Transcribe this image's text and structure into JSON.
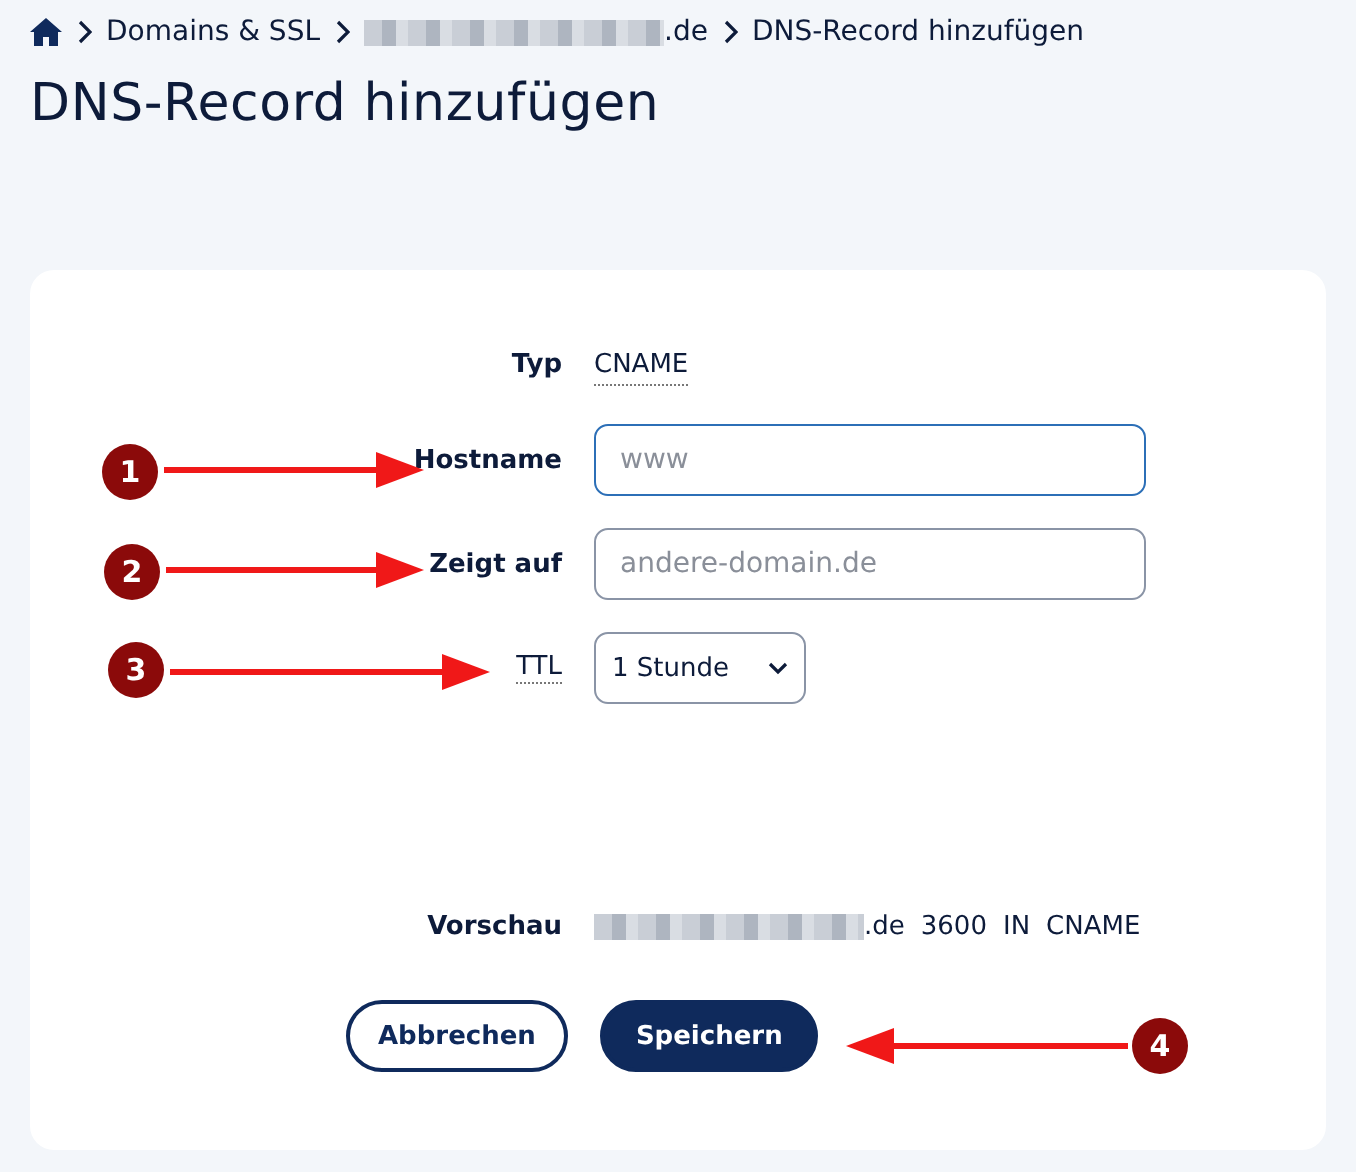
{
  "breadcrumb": [
    {
      "kind": "home"
    },
    {
      "text": "Domains & SSL",
      "redacted": false
    },
    {
      "text": ".de",
      "redacted": true
    },
    {
      "text": "DNS-Record hinzufügen",
      "redacted": false
    }
  ],
  "title": "DNS-Record hinzufügen",
  "form": {
    "rows": [
      {
        "kind": "static",
        "label": "Typ",
        "value": "CNAME"
      },
      {
        "kind": "input",
        "label": "Hostname",
        "placeholder": "www",
        "focused": true
      },
      {
        "kind": "input",
        "label": "Zeigt auf",
        "placeholder": "andere-domain.de",
        "focused": false
      },
      {
        "kind": "select",
        "label": "TTL",
        "value": "1 Stunde"
      }
    ],
    "preview": {
      "label": "Vorschau",
      "domain": ".de",
      "redacted": true,
      "parts": [
        "3600",
        "IN",
        "CNAME"
      ]
    },
    "buttons": [
      {
        "kind": "secondary",
        "label": "Abbrechen"
      },
      {
        "kind": "primary",
        "label": "Speichern"
      }
    ]
  },
  "annotations": [
    {
      "number": "1"
    },
    {
      "number": "2"
    },
    {
      "number": "3"
    },
    {
      "number": "4"
    }
  ]
}
